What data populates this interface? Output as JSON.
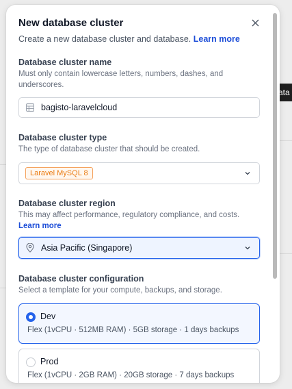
{
  "modal": {
    "title": "New database cluster",
    "subtitle": "Create a new database cluster and database.",
    "learn_more": "Learn more"
  },
  "name_section": {
    "label": "Database cluster name",
    "help": "Must only contain lowercase letters, numbers, dashes, and underscores.",
    "value": "bagisto-laravelcloud",
    "icon": "database-table-icon"
  },
  "type_section": {
    "label": "Database cluster type",
    "help": "The type of database cluster that should be created.",
    "selected": "Laravel MySQL 8",
    "badge_color": "#ea7b12"
  },
  "region_section": {
    "label": "Database cluster region",
    "help": "This may affect performance, regulatory compliance, and costs.",
    "learn_more": "Learn more",
    "selected": "Asia Pacific (Singapore)",
    "icon": "map-pin-icon"
  },
  "config_section": {
    "label": "Database cluster configuration",
    "help": "Select a template for your compute, backups, and storage.",
    "options": [
      {
        "name": "Dev",
        "desc": "Flex (1vCPU · 512MB RAM) · 5GB storage · 1 days backups",
        "selected": true
      },
      {
        "name": "Prod",
        "desc": "Flex (1vCPU · 2GB RAM) · 20GB storage · 7 days backups",
        "selected": false
      }
    ]
  },
  "background": {
    "dark_fragment": "ata",
    "accent": "#2563eb"
  }
}
